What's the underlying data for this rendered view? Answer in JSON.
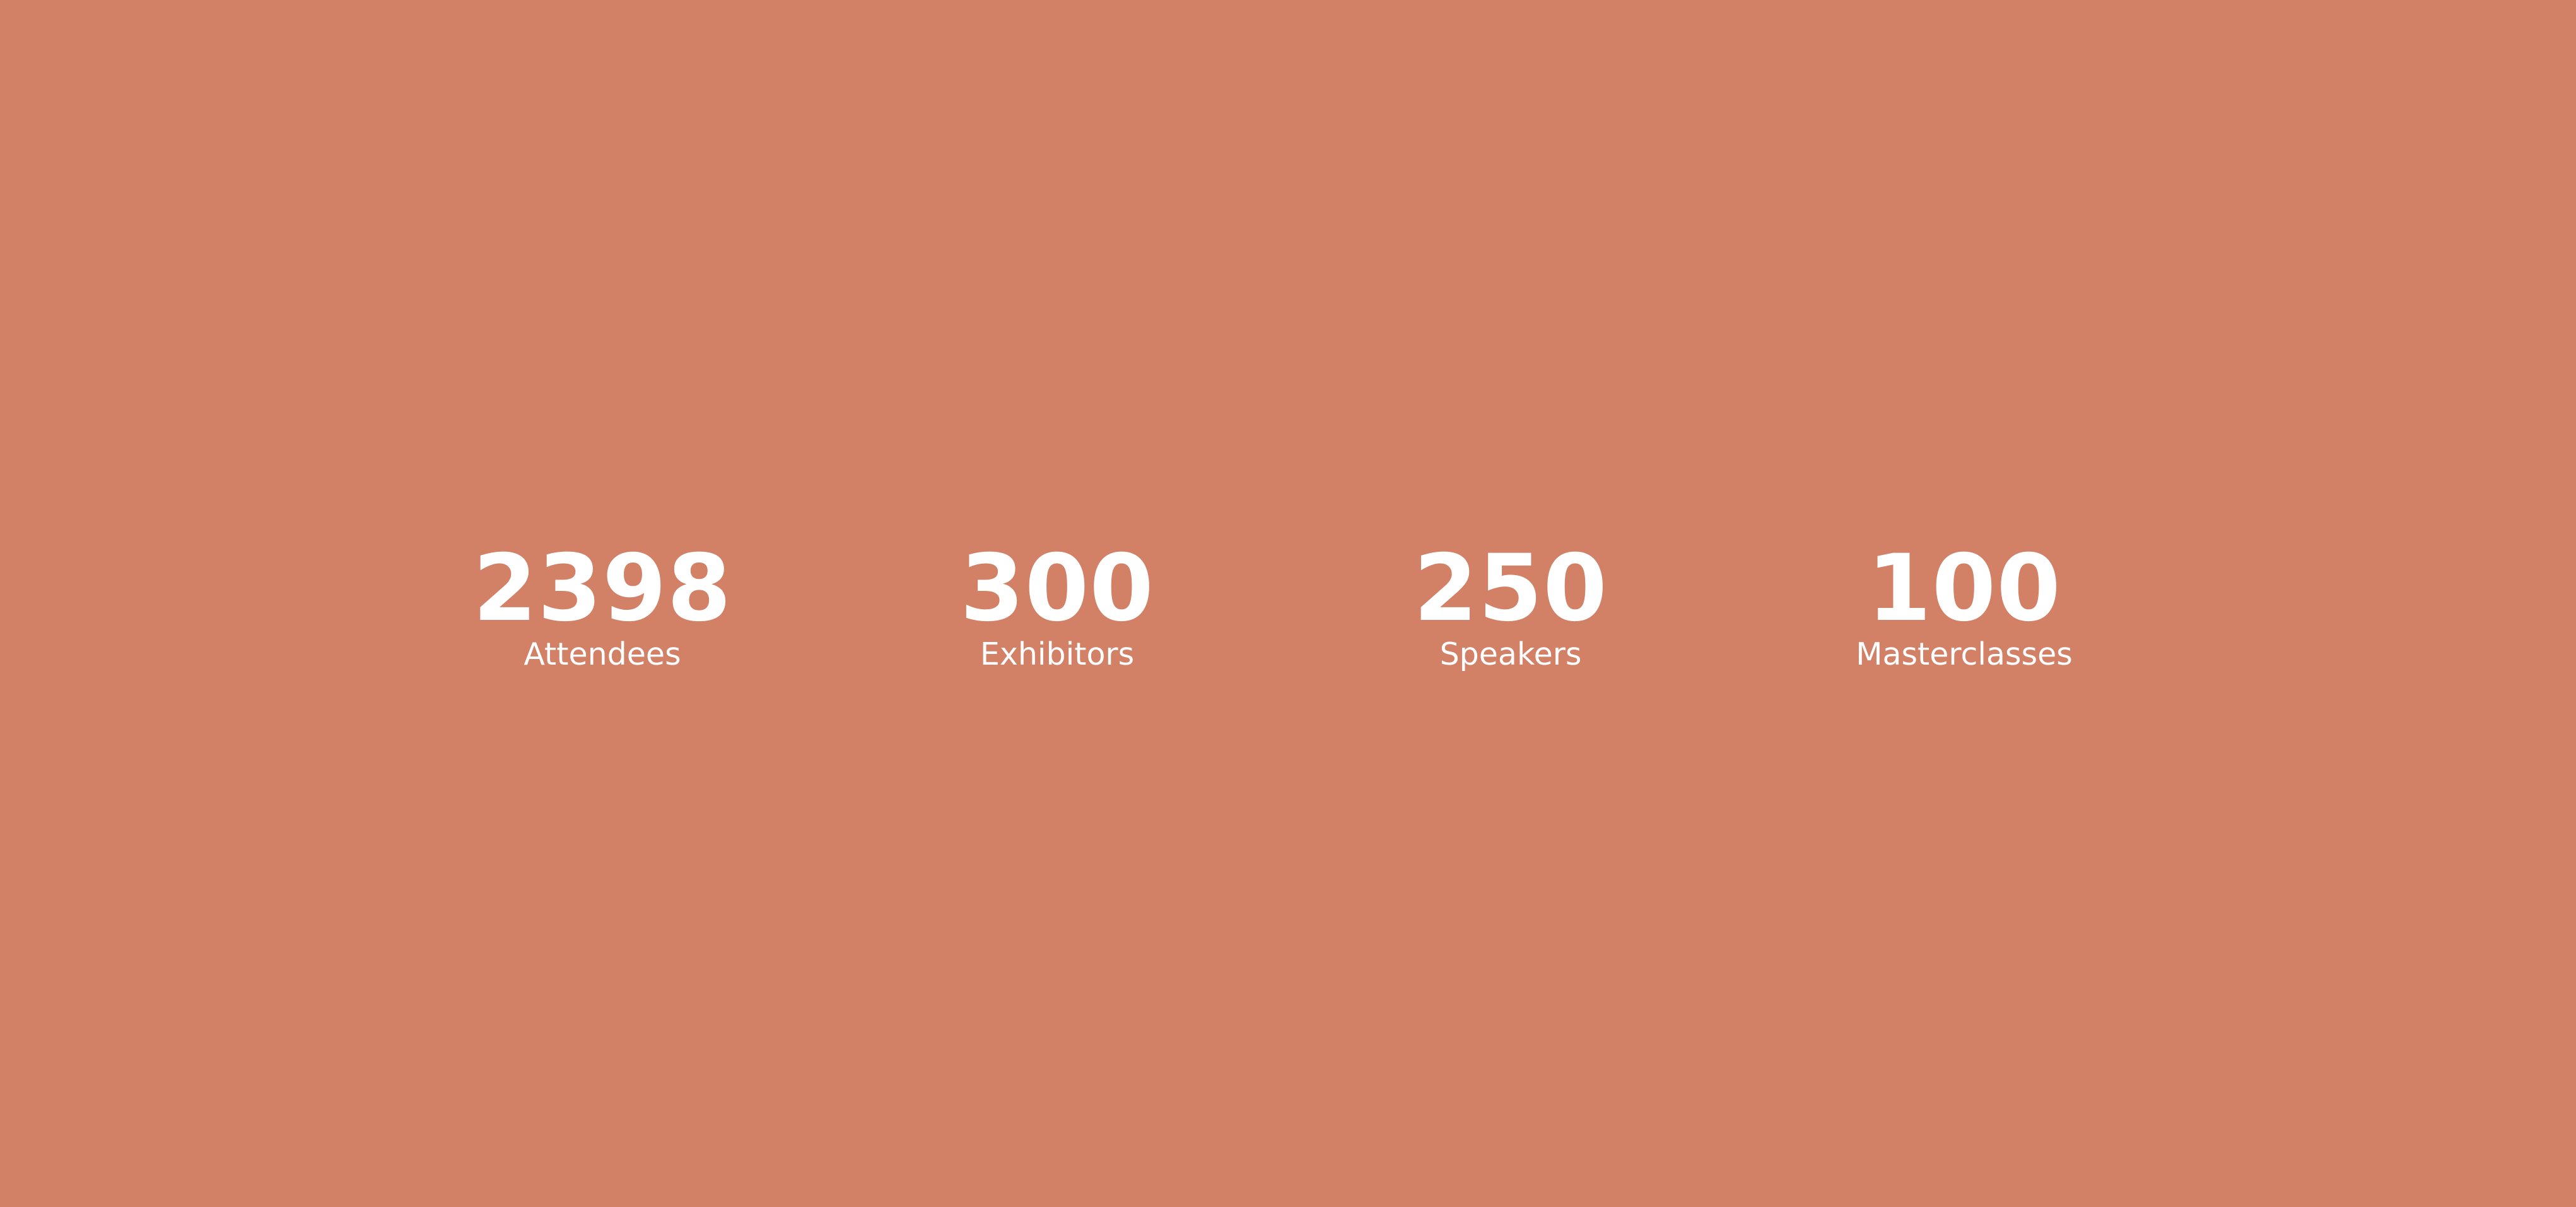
{
  "page": {
    "background_color": "#d28066",
    "text_color": "#ffffff"
  },
  "stats": [
    {
      "value": "2398",
      "label": "Attendees"
    },
    {
      "value": "300",
      "label": "Exhibitors"
    },
    {
      "value": "250",
      "label": "Speakers"
    },
    {
      "value": "100",
      "label": "Masterclasses"
    }
  ]
}
